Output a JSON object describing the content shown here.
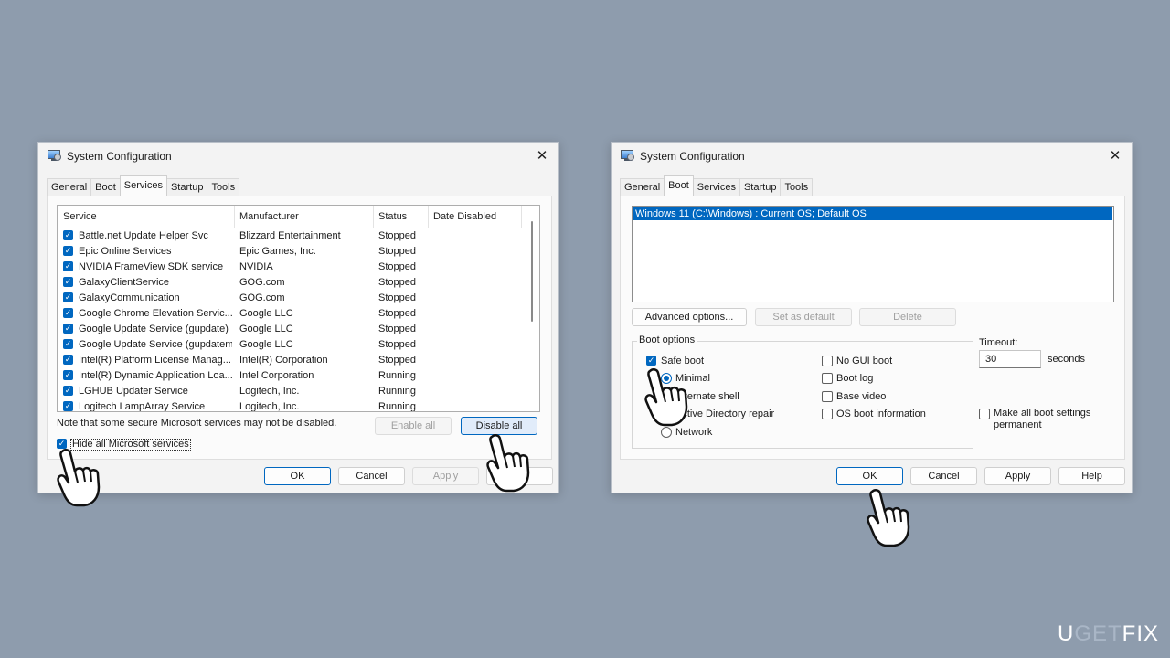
{
  "window1": {
    "title": "System Configuration",
    "close": "✕",
    "tabs": [
      "General",
      "Boot",
      "Services",
      "Startup",
      "Tools"
    ],
    "active_tab": "Services",
    "columns": [
      "Service",
      "Manufacturer",
      "Status",
      "Date Disabled"
    ],
    "rows": [
      {
        "service": "Battle.net Update Helper Svc",
        "manufacturer": "Blizzard Entertainment",
        "status": "Stopped",
        "checked": true
      },
      {
        "service": "Epic Online Services",
        "manufacturer": "Epic Games, Inc.",
        "status": "Stopped",
        "checked": true
      },
      {
        "service": "NVIDIA FrameView SDK service",
        "manufacturer": "NVIDIA",
        "status": "Stopped",
        "checked": true
      },
      {
        "service": "GalaxyClientService",
        "manufacturer": "GOG.com",
        "status": "Stopped",
        "checked": true
      },
      {
        "service": "GalaxyCommunication",
        "manufacturer": "GOG.com",
        "status": "Stopped",
        "checked": true
      },
      {
        "service": "Google Chrome Elevation Servic...",
        "manufacturer": "Google LLC",
        "status": "Stopped",
        "checked": true
      },
      {
        "service": "Google Update Service (gupdate)",
        "manufacturer": "Google LLC",
        "status": "Stopped",
        "checked": true
      },
      {
        "service": "Google Update Service (gupdatem)",
        "manufacturer": "Google LLC",
        "status": "Stopped",
        "checked": true
      },
      {
        "service": "Intel(R) Platform License Manag...",
        "manufacturer": "Intel(R) Corporation",
        "status": "Stopped",
        "checked": true
      },
      {
        "service": "Intel(R) Dynamic Application Loa...",
        "manufacturer": "Intel Corporation",
        "status": "Running",
        "checked": true
      },
      {
        "service": "LGHUB Updater Service",
        "manufacturer": "Logitech, Inc.",
        "status": "Running",
        "checked": true
      },
      {
        "service": "Logitech LampArray Service",
        "manufacturer": "Logitech, Inc.",
        "status": "Running",
        "checked": true
      }
    ],
    "note": "Note that some secure Microsoft services may not be disabled.",
    "enable_all": "Enable all",
    "disable_all": "Disable all",
    "hide_ms": "Hide all Microsoft services",
    "hide_ms_checked": true,
    "ok": "OK",
    "cancel": "Cancel",
    "apply": "Apply"
  },
  "window2": {
    "title": "System Configuration",
    "close": "✕",
    "tabs": [
      "General",
      "Boot",
      "Services",
      "Startup",
      "Tools"
    ],
    "active_tab": "Boot",
    "os_entry": "Windows 11 (C:\\Windows) : Current OS; Default OS",
    "advanced_options": "Advanced options...",
    "set_default": "Set as default",
    "delete": "Delete",
    "boot_options_label": "Boot options",
    "safe_boot": "Safe boot",
    "minimal": "Minimal",
    "alternate_shell": "Alternate shell",
    "ad_repair": "Active Directory repair",
    "network": "Network",
    "no_gui_boot": "No GUI boot",
    "boot_log": "Boot log",
    "base_video": "Base video",
    "os_boot_info": "OS boot information",
    "timeout_label": "Timeout:",
    "timeout_value": "30",
    "seconds": "seconds",
    "make_permanent": "Make all boot settings permanent",
    "ok": "OK",
    "cancel": "Cancel",
    "apply": "Apply",
    "help": "Help"
  },
  "logo": {
    "part1": "U",
    "part2": "GET",
    "part3": "FIX"
  },
  "colors": {
    "accent": "#0067c0",
    "background": "#8e9cad"
  }
}
